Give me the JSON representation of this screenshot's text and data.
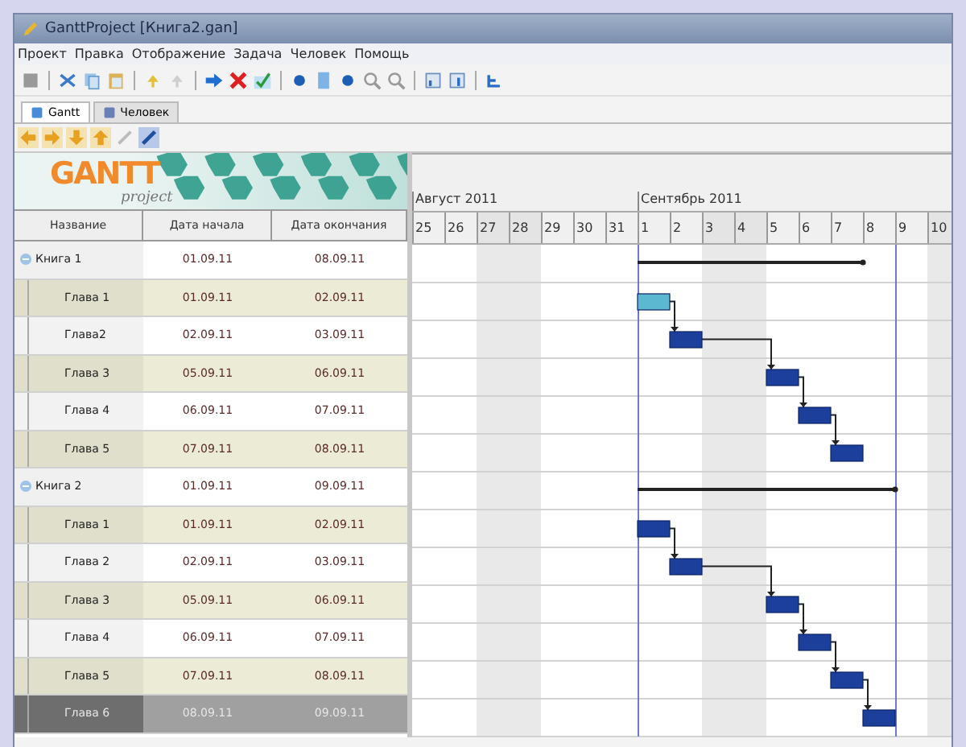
{
  "window": {
    "title": "GanttProject [Книга2.gan]"
  },
  "menu": [
    "Проект",
    "Правка",
    "Отображение",
    "Задача",
    "Человек",
    "Помощь"
  ],
  "tabs": [
    {
      "label": "Gantt",
      "selected": true
    },
    {
      "label": "Человек",
      "selected": false
    }
  ],
  "logo": {
    "title": "GANTT",
    "subtitle": "project"
  },
  "table": {
    "columns": [
      "Название",
      "Дата начала",
      "Дата окончания"
    ],
    "rows": [
      {
        "name": "Книга 1",
        "start": "01.09.11",
        "end": "08.09.11",
        "expanded": true,
        "selected": false,
        "children": [
          {
            "name": "Глава 1",
            "start": "01.09.11",
            "end": "02.09.11",
            "selected": false,
            "color": "#5bb8d0"
          },
          {
            "name": "Глава2",
            "start": "02.09.11",
            "end": "03.09.11",
            "selected": false,
            "color": "#1c3f9c"
          },
          {
            "name": "Глава 3",
            "start": "05.09.11",
            "end": "06.09.11",
            "selected": false,
            "color": "#1c3f9c"
          },
          {
            "name": "Глава 4",
            "start": "06.09.11",
            "end": "07.09.11",
            "selected": false,
            "color": "#1c3f9c"
          },
          {
            "name": "Глава 5",
            "start": "07.09.11",
            "end": "08.09.11",
            "selected": false,
            "color": "#1c3f9c"
          }
        ]
      },
      {
        "name": "Книга 2",
        "start": "01.09.11",
        "end": "09.09.11",
        "expanded": true,
        "selected": false,
        "children": [
          {
            "name": "Глава 1",
            "start": "01.09.11",
            "end": "02.09.11",
            "selected": false,
            "color": "#1c3f9c"
          },
          {
            "name": "Глава 2",
            "start": "02.09.11",
            "end": "03.09.11",
            "selected": false,
            "color": "#1c3f9c"
          },
          {
            "name": "Глава 3",
            "start": "05.09.11",
            "end": "06.09.11",
            "selected": false,
            "color": "#1c3f9c"
          },
          {
            "name": "Глава 4",
            "start": "06.09.11",
            "end": "07.09.11",
            "selected": false,
            "color": "#1c3f9c"
          },
          {
            "name": "Глава 5",
            "start": "07.09.11",
            "end": "08.09.11",
            "selected": false,
            "color": "#1c3f9c"
          },
          {
            "name": "Глава 6",
            "start": "08.09.11",
            "end": "09.09.11",
            "selected": true,
            "color": "#1c3f9c"
          }
        ]
      }
    ]
  },
  "timeline": {
    "months": [
      {
        "label": "Август 2011",
        "days": [
          {
            "label": "25",
            "weekend": false
          },
          {
            "label": "26",
            "weekend": false
          },
          {
            "label": "27",
            "weekend": true
          },
          {
            "label": "28",
            "weekend": true
          },
          {
            "label": "29",
            "weekend": false
          },
          {
            "label": "30",
            "weekend": false
          },
          {
            "label": "31",
            "weekend": false
          }
        ]
      },
      {
        "label": "Сентябрь 2011",
        "days": [
          {
            "label": "1",
            "weekend": false
          },
          {
            "label": "2",
            "weekend": false
          },
          {
            "label": "3",
            "weekend": true
          },
          {
            "label": "4",
            "weekend": true
          },
          {
            "label": "5",
            "weekend": false
          },
          {
            "label": "6",
            "weekend": false
          },
          {
            "label": "7",
            "weekend": false
          },
          {
            "label": "8",
            "weekend": false
          },
          {
            "label": "9",
            "weekend": false
          },
          {
            "label": "10",
            "weekend": true
          }
        ]
      }
    ]
  }
}
